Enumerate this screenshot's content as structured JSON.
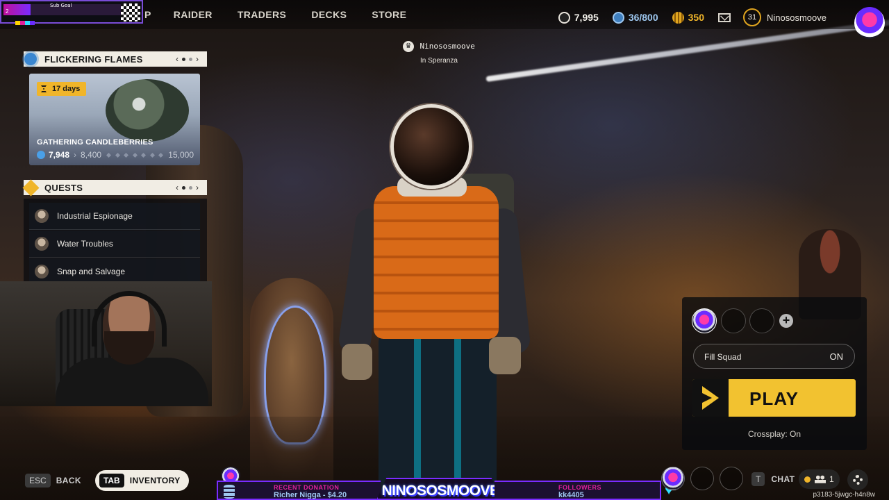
{
  "subgoal": {
    "label": "Sub Goal",
    "current": "2",
    "target": "10"
  },
  "nav": {
    "items": [
      "P",
      "RAIDER",
      "TRADERS",
      "DECKS",
      "STORE"
    ]
  },
  "currencies": {
    "coins": "7,995",
    "blue": "36/800",
    "gold": "350"
  },
  "user": {
    "level": "31",
    "name": "Ninososmoove"
  },
  "player_tag": {
    "name": "Ninososmoove",
    "location": "In Speranza"
  },
  "event": {
    "title": "FLICKERING FLAMES",
    "days": "17  days",
    "name": "GATHERING CANDLEBERRIES",
    "current": "7,948",
    "next": "8,400",
    "max": "15,000",
    "progress": 0.53
  },
  "quests": {
    "title": "QUESTS",
    "items": [
      "Industrial Espionage",
      "Water Troubles",
      "Snap and Salvage"
    ]
  },
  "squad": {
    "fill_squad_label": "Fill Squad",
    "fill_squad_value": "ON",
    "play_label": "PLAY",
    "crossplay": "Crossplay: On"
  },
  "bottom": {
    "esc_key": "ESC",
    "back_label": "BACK",
    "tab_key": "TAB",
    "inventory_label": "INVENTORY",
    "chat_key": "T",
    "chat_label": "CHAT",
    "online_count": "1",
    "session_code": "p3183-5jwgc-h4n8w"
  },
  "stream_overlay": {
    "donation_caption": "RECENT DONATION",
    "donation_value": "Richer Nigga - $4.20",
    "channel_name": "NINOSOSMOOVE",
    "followers_caption": "FOLLOWERS",
    "followers_value": "kk4405"
  },
  "colors": {
    "accent_yellow": "#f2c230",
    "nav_text": "#d9d5cc",
    "overlay_purple": "#7a2cff"
  }
}
